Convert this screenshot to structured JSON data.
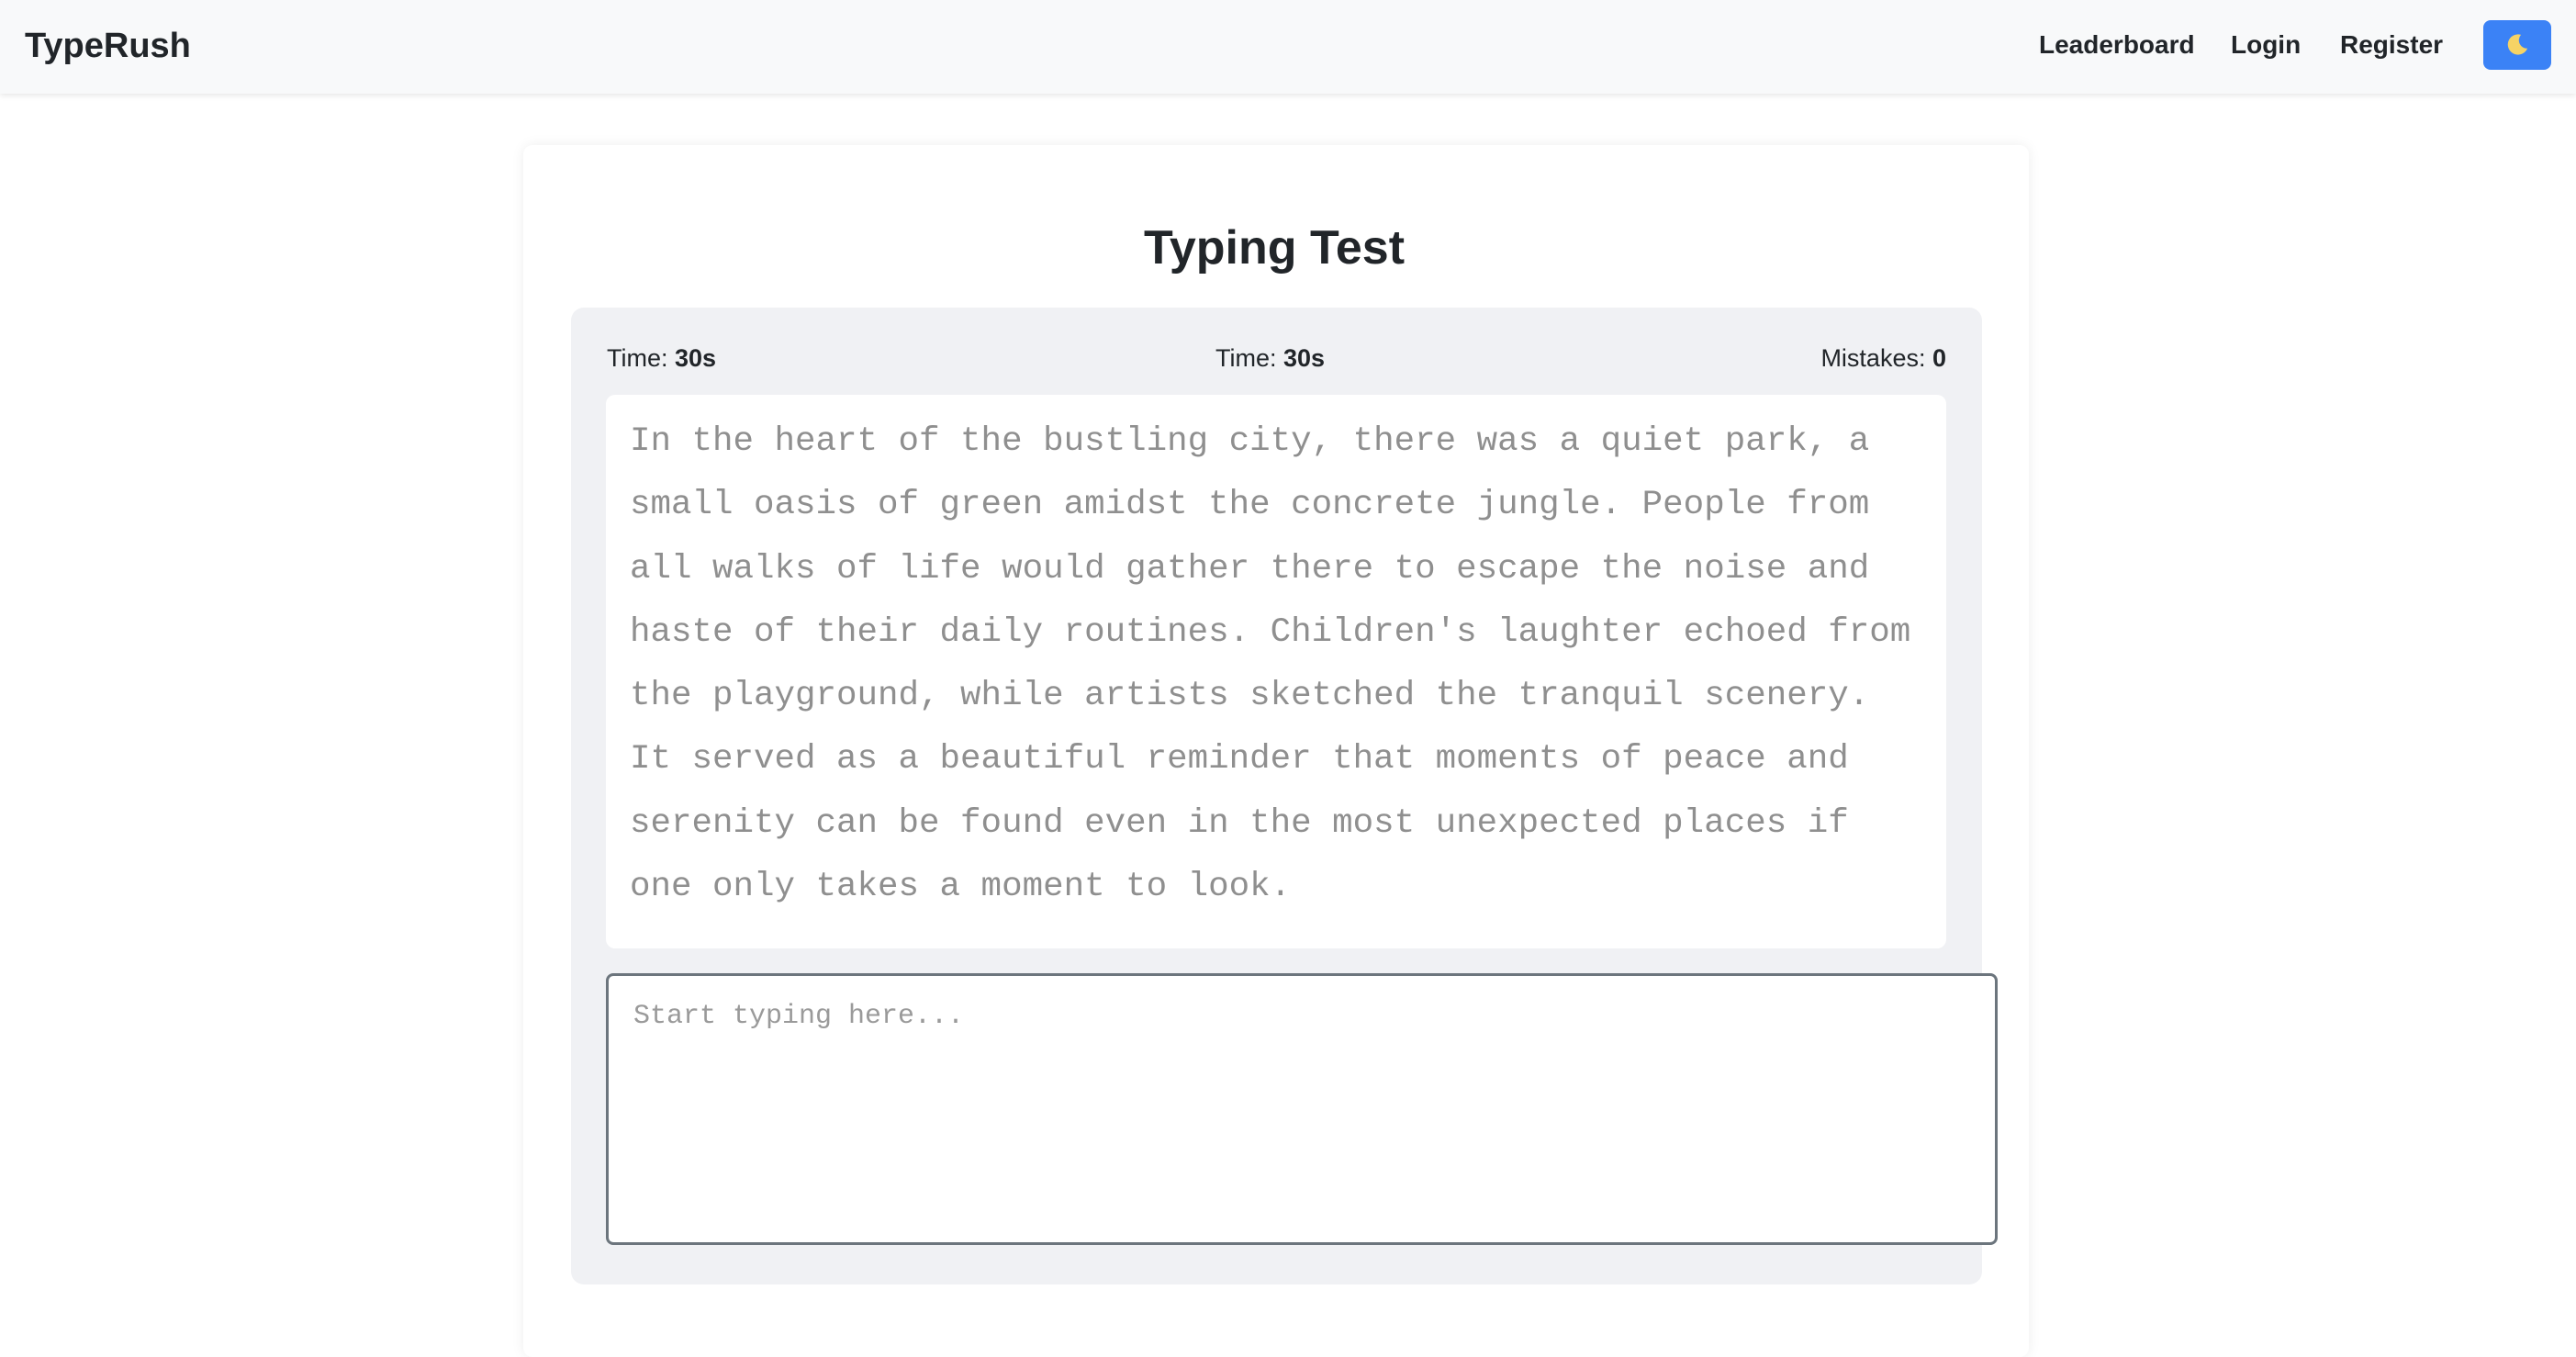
{
  "navbar": {
    "brand": "TypeRush",
    "links": {
      "leaderboard": "Leaderboard",
      "login": "Login",
      "register": "Register"
    },
    "theme_toggle": {
      "icon": "moon-icon",
      "accent_color": "#3b82f6"
    }
  },
  "main": {
    "title": "Typing Test",
    "stats": {
      "time_1": {
        "label": "Time: ",
        "value": "30s"
      },
      "time_2": {
        "label": "Time: ",
        "value": "30s"
      },
      "mistakes": {
        "label": "Mistakes: ",
        "value": "0"
      }
    },
    "passage": "In the heart of the bustling city, there was a quiet park, a small oasis of green amidst the concrete jungle. People from all walks of life would gather there to escape the noise and haste of their daily routines. Children's laughter echoed from the playground, while artists sketched the tranquil scenery. It served as a beautiful reminder that moments of peace and serenity can be found even in the most unexpected places if one only takes a moment to look.",
    "input": {
      "placeholder": "Start typing here...",
      "value": ""
    }
  }
}
